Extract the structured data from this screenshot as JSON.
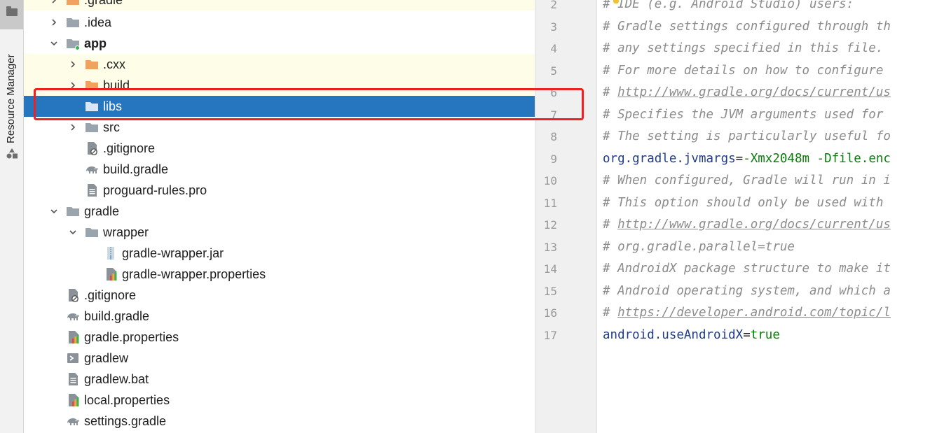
{
  "sidebar": {
    "label": "Resource Manager"
  },
  "tree": {
    "items": [
      {
        "label": ".gradle",
        "icon": "folder-orange-icon",
        "chevron": "right"
      },
      {
        "label": ".idea",
        "icon": "folder-icon",
        "chevron": "right"
      },
      {
        "label": "app",
        "icon": "module-folder-icon",
        "chevron": "down",
        "bold": true
      },
      {
        "label": ".cxx",
        "icon": "folder-orange-icon",
        "chevron": "right"
      },
      {
        "label": "build",
        "icon": "folder-orange-icon",
        "chevron": "right"
      },
      {
        "label": "libs",
        "icon": "folder-icon",
        "chevron": "none",
        "selected": true
      },
      {
        "label": "src",
        "icon": "folder-icon",
        "chevron": "right"
      },
      {
        "label": ".gitignore",
        "icon": "gitignore-file-icon",
        "chevron": "none"
      },
      {
        "label": "build.gradle",
        "icon": "gradle-elephant-icon",
        "chevron": "none"
      },
      {
        "label": "proguard-rules.pro",
        "icon": "text-file-icon",
        "chevron": "none"
      },
      {
        "label": "gradle",
        "icon": "folder-icon",
        "chevron": "down"
      },
      {
        "label": "wrapper",
        "icon": "folder-icon",
        "chevron": "down"
      },
      {
        "label": "gradle-wrapper.jar",
        "icon": "jar-file-icon",
        "chevron": "none"
      },
      {
        "label": "gradle-wrapper.properties",
        "icon": "properties-file-icon",
        "chevron": "none"
      },
      {
        "label": ".gitignore",
        "icon": "gitignore-file-icon",
        "chevron": "none"
      },
      {
        "label": "build.gradle",
        "icon": "gradle-elephant-icon",
        "chevron": "none"
      },
      {
        "label": "gradle.properties",
        "icon": "properties-file-icon",
        "chevron": "none"
      },
      {
        "label": "gradlew",
        "icon": "shell-script-icon",
        "chevron": "none"
      },
      {
        "label": "gradlew.bat",
        "icon": "text-file-icon",
        "chevron": "none"
      },
      {
        "label": "local.properties",
        "icon": "properties-file-icon",
        "chevron": "none"
      },
      {
        "label": "settings.gradle",
        "icon": "gradle-elephant-icon",
        "chevron": "none"
      }
    ]
  },
  "editor": {
    "lines": [
      {
        "num": "2",
        "parts": [
          {
            "t": "# IDE (e.g. Android Studio) users:",
            "c": "cmt"
          }
        ]
      },
      {
        "num": "3",
        "parts": [
          {
            "t": "# Gradle settings configured through th",
            "c": "cmt"
          }
        ]
      },
      {
        "num": "4",
        "parts": [
          {
            "t": "# any settings specified in this file.",
            "c": "cmt"
          }
        ]
      },
      {
        "num": "5",
        "parts": [
          {
            "t": "# For more details on how to configure",
            "c": "cmt"
          }
        ]
      },
      {
        "num": "6",
        "parts": [
          {
            "t": "# ",
            "c": "cmt"
          },
          {
            "t": "http://www.gradle.org/docs/current/us",
            "c": "url"
          }
        ]
      },
      {
        "num": "7",
        "parts": [
          {
            "t": "# Specifies the JVM arguments used for",
            "c": "cmt"
          }
        ]
      },
      {
        "num": "8",
        "parts": [
          {
            "t": "# The setting is particularly useful fo",
            "c": "cmt"
          }
        ]
      },
      {
        "num": "9",
        "parts": [
          {
            "t": "org.gradle.jvmargs",
            "c": "key"
          },
          {
            "t": "=",
            "c": "eq"
          },
          {
            "t": "-Xmx2048m -Dfile.enc",
            "c": "val"
          }
        ]
      },
      {
        "num": "10",
        "parts": [
          {
            "t": "# When configured, Gradle will run in i",
            "c": "cmt"
          }
        ]
      },
      {
        "num": "11",
        "parts": [
          {
            "t": "# This option should only be used with",
            "c": "cmt"
          }
        ]
      },
      {
        "num": "12",
        "parts": [
          {
            "t": "# ",
            "c": "cmt"
          },
          {
            "t": "http://www.gradle.org/docs/current/us",
            "c": "url"
          }
        ]
      },
      {
        "num": "13",
        "parts": [
          {
            "t": "# org.gradle.parallel=true",
            "c": "cmt"
          }
        ]
      },
      {
        "num": "14",
        "parts": [
          {
            "t": "# AndroidX package structure to make it",
            "c": "cmt"
          }
        ]
      },
      {
        "num": "15",
        "parts": [
          {
            "t": "# Android operating system, and which a",
            "c": "cmt"
          }
        ]
      },
      {
        "num": "16",
        "parts": [
          {
            "t": "# ",
            "c": "cmt"
          },
          {
            "t": "https://developer.android.com/topic/l",
            "c": "url"
          }
        ]
      },
      {
        "num": "17",
        "parts": [
          {
            "t": "android.useAndroidX",
            "c": "key"
          },
          {
            "t": "=",
            "c": "eq"
          },
          {
            "t": "true",
            "c": "val"
          }
        ]
      }
    ]
  },
  "colors": {
    "selection": "#2675bf",
    "excluded_folder": "#f0a35e",
    "highlight_box": "#ef2020"
  }
}
